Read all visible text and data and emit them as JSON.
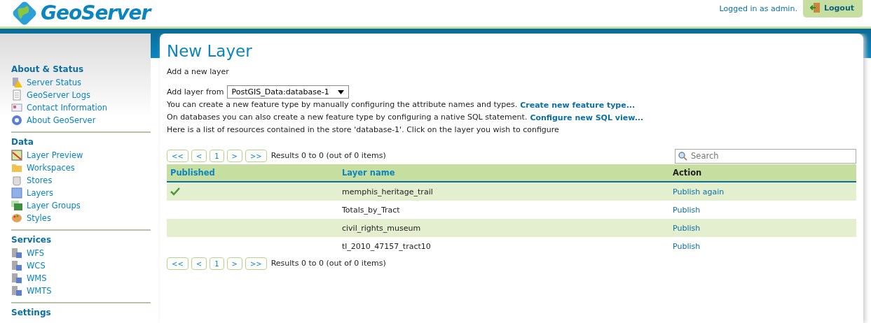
{
  "header": {
    "logo_text": "GeoServer",
    "login_text": "Logged in as admin.",
    "logout": "Logout"
  },
  "sidebar": [
    {
      "title": "About & Status",
      "items": [
        {
          "label": "Server Status"
        },
        {
          "label": "GeoServer Logs"
        },
        {
          "label": "Contact Information"
        },
        {
          "label": "About GeoServer"
        }
      ]
    },
    {
      "title": "Data",
      "items": [
        {
          "label": "Layer Preview"
        },
        {
          "label": "Workspaces"
        },
        {
          "label": "Stores"
        },
        {
          "label": "Layers"
        },
        {
          "label": "Layer Groups"
        },
        {
          "label": "Styles"
        }
      ]
    },
    {
      "title": "Services",
      "items": [
        {
          "label": "WFS"
        },
        {
          "label": "WCS"
        },
        {
          "label": "WMS"
        },
        {
          "label": "WMTS"
        }
      ]
    },
    {
      "title": "Settings"
    }
  ],
  "page": {
    "title": "New Layer",
    "subtitle": "Add a new layer",
    "store_label": "Add layer from",
    "store_value": "PostGIS_Data:database-1",
    "lines": [
      {
        "text": "You can create a new feature type by manually configuring the attribute names and types.",
        "link": "Create new feature type..."
      },
      {
        "text": "On databases you can also create a new feature type by configuring a native SQL statement.",
        "link": "Configure new SQL view..."
      },
      {
        "text": "Here is a list of resources contained in the store 'database-1'. Click on the layer you wish to configure"
      }
    ]
  },
  "pager_top": {
    "buttons": [
      "<<",
      "<",
      "1",
      ">",
      ">>"
    ],
    "results": "Results 0 to 0 (out of 0 items)"
  },
  "search": {
    "placeholder": "Search"
  },
  "table": {
    "columns": [
      "Published",
      "Layer name",
      "Action"
    ],
    "rows": [
      {
        "published": true,
        "name": "memphis_heritage_trail",
        "action": "Publish again"
      },
      {
        "published": false,
        "name": "Totals_by_Tract",
        "action": "Publish"
      },
      {
        "published": false,
        "name": "civil_rights_museum",
        "action": "Publish"
      },
      {
        "published": false,
        "name": "tl_2010_47157_tract10",
        "action": "Publish"
      }
    ]
  },
  "pager_bottom": {
    "buttons": [
      "<<",
      "<",
      "1",
      ">",
      ">>"
    ],
    "results": "Results 0 to 0 (out of 0 items)"
  }
}
